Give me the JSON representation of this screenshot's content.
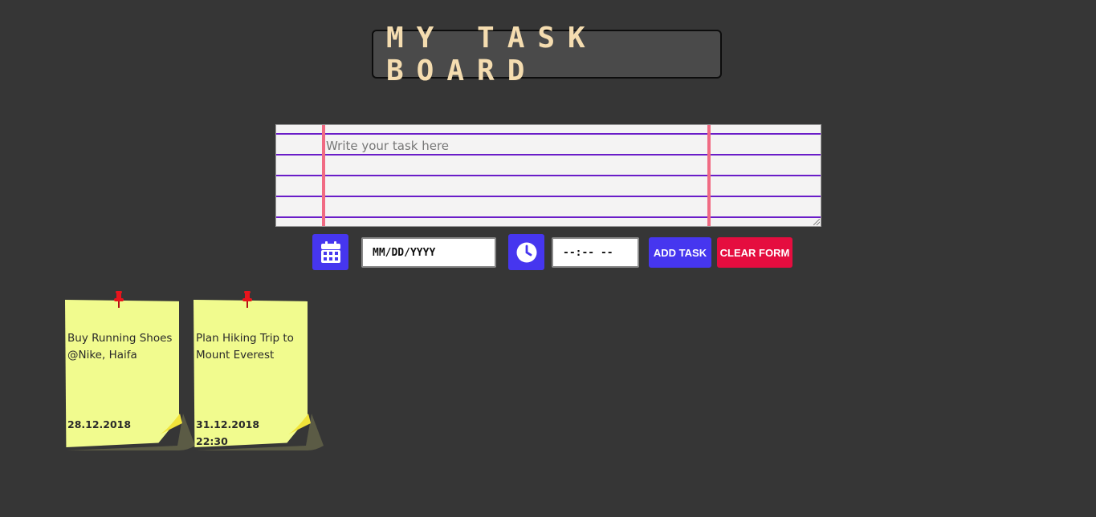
{
  "header": {
    "title": "MY TASK BOARD"
  },
  "form": {
    "task_placeholder": "Write your task here",
    "date_placeholder": "MM/DD/YYYY",
    "time_placeholder": "--:-- --",
    "add_label": "ADD TASK",
    "clear_label": "CLEAR FORM",
    "calendar_icon": "calendar-icon",
    "clock_icon": "clock-icon"
  },
  "colors": {
    "background": "#363636",
    "title_text": "#f5ddb0",
    "accent_blue": "#4636ef",
    "accent_red": "#e50d3f",
    "note_yellow": "#f1fb8e",
    "pin_red": "#e8141c"
  },
  "notes": [
    {
      "text": "Buy Running Shoes @Nike, Haifa",
      "date": "28.12.2018",
      "time": ""
    },
    {
      "text": "Plan Hiking Trip to Mount Everest",
      "date": "31.12.2018",
      "time": "22:30"
    }
  ]
}
